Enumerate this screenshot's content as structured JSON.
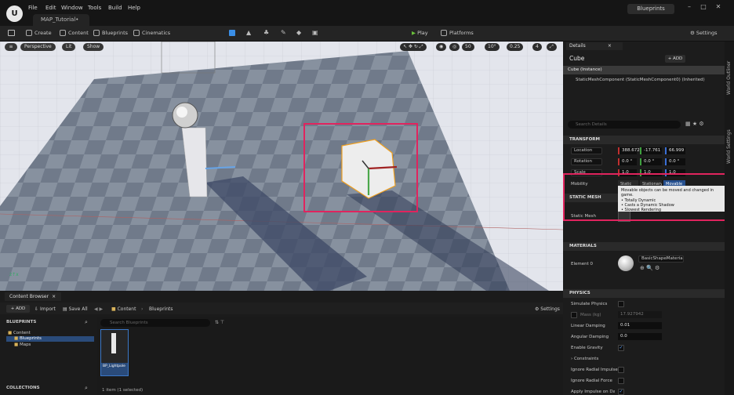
{
  "window": {
    "menu": [
      "File",
      "Edit",
      "Window",
      "Tools",
      "Build",
      "Help"
    ],
    "tab": "MAP_Tutorial•",
    "badge": "Blueprints",
    "controls": [
      "–",
      "□",
      "✕"
    ]
  },
  "toolbar": {
    "create": "Create",
    "content": "Content",
    "blueprints": "Blueprints",
    "cinematics": "Cinematics",
    "play": "Play",
    "platforms": "Platforms",
    "settings": "Settings"
  },
  "viewport": {
    "perspective": "Perspective",
    "lit": "Lit",
    "show": "Show",
    "grid_snap": "50",
    "angle_snap": "10°",
    "scale_snap": "0.25",
    "camera_speed": "4"
  },
  "details": {
    "tab": "Details",
    "actor": "Cube",
    "add": "+ ADD",
    "instance": "Cube (Instance)",
    "component": "StaticMeshComponent (StaticMeshComponent0) (Inherited)",
    "search_placeholder": "Search Details",
    "transform": {
      "header": "TRANSFORM",
      "location_label": "Location",
      "location": [
        "388.672",
        "-17.761",
        "66.999"
      ],
      "rotation_label": "Rotation",
      "rotation": [
        "0.0 °",
        "0.0 °",
        "0.0 °"
      ],
      "scale_label": "Scale",
      "scale": [
        "1.0",
        "1.0",
        "1.0"
      ]
    },
    "mobility": {
      "label": "Mobility",
      "options": [
        "Static",
        "Stationary",
        "Movable"
      ],
      "selected": "Movable"
    },
    "tooltip": {
      "line1": "Movable objects can be moved and changed in game.",
      "line2": "• Totally Dynamic",
      "line3": "• Casts a Dynamic Shadow",
      "line4": "• Slowest Rendering"
    },
    "static_mesh": {
      "header": "STATIC MESH",
      "label": "Static Mesh"
    },
    "materials": {
      "header": "MATERIALS",
      "label": "Element 0",
      "value": "BasicShapeMaterial"
    },
    "physics": {
      "header": "PHYSICS",
      "simulate": "Simulate Physics",
      "mass": "Mass (kg)",
      "mass_value": "17.927942",
      "linear_damping": "Linear Damping",
      "linear_damping_value": "0.01",
      "angular_damping": "Angular Damping",
      "angular_damping_value": "0.0",
      "gravity": "Enable Gravity",
      "constraints": "Constraints",
      "ignore_radial_impulse": "Ignore Radial Impulse",
      "ignore_radial_force": "Ignore Radial Force",
      "apply_impulse": "Apply Impulse on Damage"
    }
  },
  "side_tabs": [
    "World Outliner",
    "World Settings"
  ],
  "content_browser": {
    "tab": "Content Browser",
    "add": "ADD",
    "import": "Import",
    "save_all": "Save All",
    "path": [
      "Content",
      "Blueprints"
    ],
    "settings": "Settings",
    "tree_header": "BLUEPRINTS",
    "tree": [
      "Content",
      "Blueprints",
      "Maps"
    ],
    "search_placeholder": "Search Blueprints",
    "asset": "BP_Lightpole",
    "collections": "COLLECTIONS",
    "status": "1 item (1 selected)"
  }
}
